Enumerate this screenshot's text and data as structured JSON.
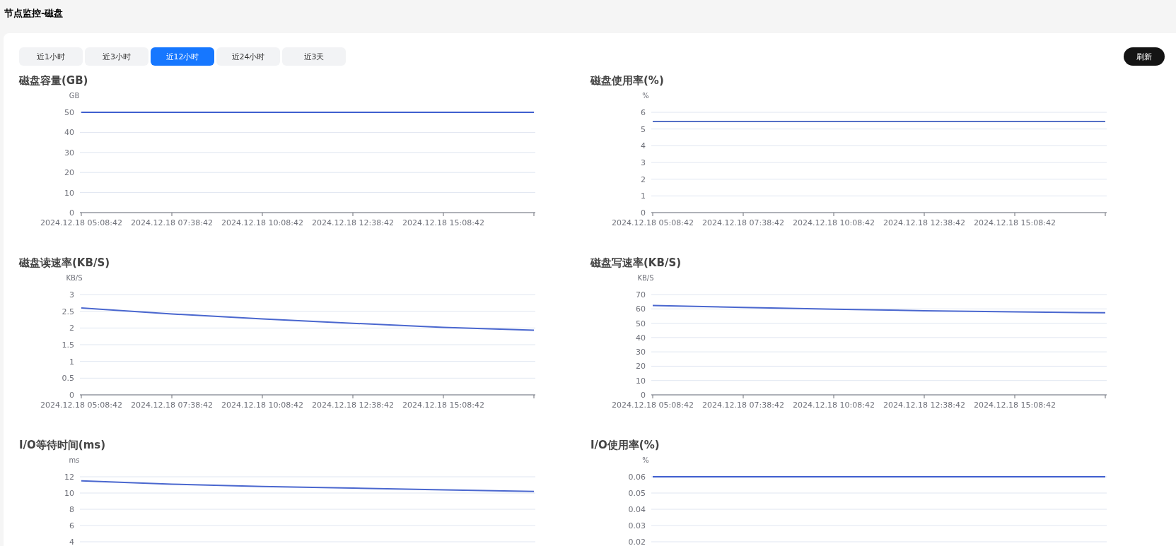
{
  "page_title": "节点监控-磁盘",
  "tabs": [
    {
      "label": "近1小时",
      "selected": false
    },
    {
      "label": "近3小时",
      "selected": false
    },
    {
      "label": "近12小时",
      "selected": true
    },
    {
      "label": "近24小时",
      "selected": false
    },
    {
      "label": "近3天",
      "selected": false
    }
  ],
  "refresh_button": "刷新",
  "charts": [
    {
      "chart_data": {
        "type": "line",
        "grid": true,
        "title": "磁盘容量(GB)",
        "ylabel": "GB",
        "categories": [
          "2024.12.18 05:08:42",
          "2024.12.18 07:38:42",
          "2024.12.18 10:08:42",
          "2024.12.18 12:38:42",
          "2024.12.18 15:08:42",
          null
        ],
        "ylim": [
          0,
          50
        ],
        "yticks": [
          0,
          10,
          20,
          30,
          40,
          50
        ],
        "series": [
          {
            "color": "#3f5fcf",
            "values": [
              50,
              50,
              50,
              50,
              50,
              50
            ]
          }
        ]
      }
    },
    {
      "chart_data": {
        "type": "line",
        "grid": true,
        "title": "磁盘使用率(%)",
        "ylabel": "%",
        "categories": [
          "2024.12.18 05:08:42",
          "2024.12.18 07:38:42",
          "2024.12.18 10:08:42",
          "2024.12.18 12:38:42",
          "2024.12.18 15:08:42",
          null
        ],
        "ylim": [
          0,
          6
        ],
        "yticks": [
          0,
          1,
          2,
          3,
          4,
          5,
          6
        ],
        "series": [
          {
            "color": "#5470c6",
            "values": [
              5.45,
              5.45,
              5.45,
              5.45,
              5.45,
              5.45
            ]
          }
        ]
      }
    },
    {
      "chart_data": {
        "type": "line",
        "grid": true,
        "title": "磁盘读速率(KB/S)",
        "ylabel": "KB/S",
        "categories": [
          "2024.12.18 05:08:42",
          "2024.12.18 07:38:42",
          "2024.12.18 10:08:42",
          "2024.12.18 12:38:42",
          "2024.12.18 15:08:42",
          null
        ],
        "ylim": [
          0,
          3
        ],
        "yticks": [
          0,
          0.5,
          1,
          1.5,
          2,
          2.5,
          3
        ],
        "series": [
          {
            "color": "#4a67cf",
            "values": [
              2.6,
              2.42,
              2.27,
              2.14,
              2.02,
              1.93
            ]
          }
        ]
      }
    },
    {
      "chart_data": {
        "type": "line",
        "grid": true,
        "title": "磁盘写速率(KB/S)",
        "ylabel": "KB/S",
        "categories": [
          "2024.12.18 05:08:42",
          "2024.12.18 07:38:42",
          "2024.12.18 10:08:42",
          "2024.12.18 12:38:42",
          "2024.12.18 15:08:42",
          null
        ],
        "ylim": [
          0,
          70
        ],
        "yticks": [
          0,
          10,
          20,
          30,
          40,
          50,
          60,
          70
        ],
        "series": [
          {
            "color": "#4a67cf",
            "values": [
              62.3,
              61,
              59.8,
              58.7,
              57.9,
              57.3
            ]
          }
        ]
      }
    },
    {
      "chart_data": {
        "type": "line",
        "grid": true,
        "title": "I/O等待时间(ms)",
        "ylabel": "ms",
        "categories": [
          null,
          null,
          null,
          null,
          null,
          null
        ],
        "ylim": [
          4,
          12
        ],
        "yticks": [
          4,
          6,
          8,
          10,
          12
        ],
        "series": [
          {
            "color": "#4a67cf",
            "values": [
              11.5,
              11.1,
              10.8,
              10.6,
              10.4,
              10.2
            ]
          }
        ]
      }
    },
    {
      "chart_data": {
        "type": "line",
        "grid": true,
        "title": "I/O使用率(%)",
        "ylabel": "%",
        "categories": [
          null,
          null,
          null,
          null,
          null,
          null
        ],
        "ylim": [
          0.02,
          0.06
        ],
        "yticks": [
          0.02,
          0.03,
          0.04,
          0.05,
          0.06
        ],
        "series": [
          {
            "color": "#3f5fcf",
            "values": [
              0.06,
              0.06,
              0.06,
              0.06,
              0.06,
              0.06
            ]
          }
        ]
      }
    }
  ]
}
